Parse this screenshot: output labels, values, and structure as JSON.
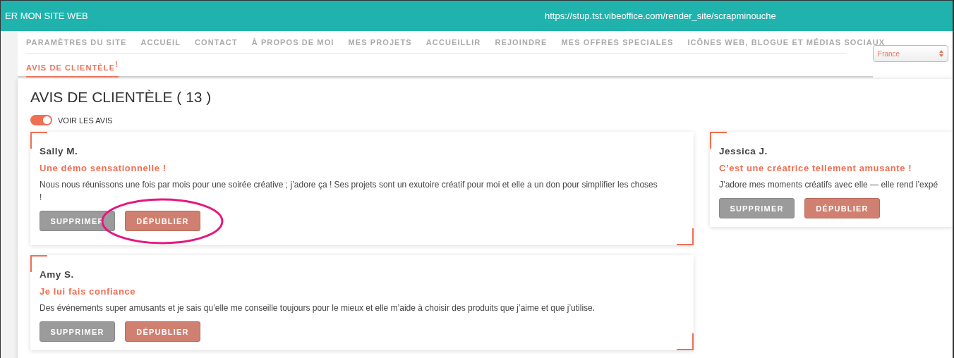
{
  "top_bar": {
    "title": "ER MON SITE WEB",
    "url": "https://stup.tst.vibeoffice.com/render_site/scrapminouche"
  },
  "nav": {
    "items": [
      {
        "label": "PARAMÈTRES DU SITE",
        "selected": false
      },
      {
        "label": "ACCUEIL",
        "selected": false
      },
      {
        "label": "CONTACT",
        "selected": false
      },
      {
        "label": "À PROPOS DE MOI",
        "selected": false
      },
      {
        "label": "MES PROJETS",
        "selected": false
      },
      {
        "label": "ACCUEILLIR",
        "selected": false
      },
      {
        "label": "REJOINDRE",
        "selected": false
      },
      {
        "label": "MES OFFRES SPECIALES",
        "selected": false
      },
      {
        "label": "ICÔNES WEB, BLOGUE ET MÉDIAS SOCIAUX",
        "selected": false
      },
      {
        "label": "AVIS DE CLIENTÈLE",
        "selected": true,
        "alert": "!"
      }
    ],
    "language_select": {
      "value": "France"
    }
  },
  "page": {
    "title": "AVIS DE CLIENTÈLE ( 13 )",
    "toggle": {
      "label": "VOIR LES AVIS",
      "on": true
    }
  },
  "reviews": [
    {
      "author": "Sally M.",
      "headline": "Une démo sensationnelle !",
      "text": "Nous nous réunissons une fois par mois pour une soirée créative ; j’adore ça ! Ses projets sont un exutoire créatif pour moi et elle a un don pour simplifier les choses !",
      "buttons": [
        {
          "label": "SUPPRIMER",
          "kind": "delete"
        },
        {
          "label": "DÉPUBLIER",
          "kind": "unpublish"
        }
      ]
    },
    {
      "author": "Jessica J.",
      "headline": "C’est une créatrice tellement amusante !",
      "text": "J’adore mes moments créatifs avec elle — elle rend l’expé",
      "buttons": [
        {
          "label": "SUPPRIMER",
          "kind": "delete"
        },
        {
          "label": "DÉPUBLIER",
          "kind": "unpublish"
        }
      ]
    },
    {
      "author": "Amy S.",
      "headline": "Je lui fais confiance",
      "text": "Des événements super amusants et je sais qu’elle me conseille toujours pour le mieux et elle m’aide à choisir des produits que j’aime et que j’utilise.",
      "buttons": [
        {
          "label": "SUPPRIMER",
          "kind": "delete"
        },
        {
          "label": "DÉPUBLIER",
          "kind": "unpublish"
        }
      ]
    }
  ]
}
